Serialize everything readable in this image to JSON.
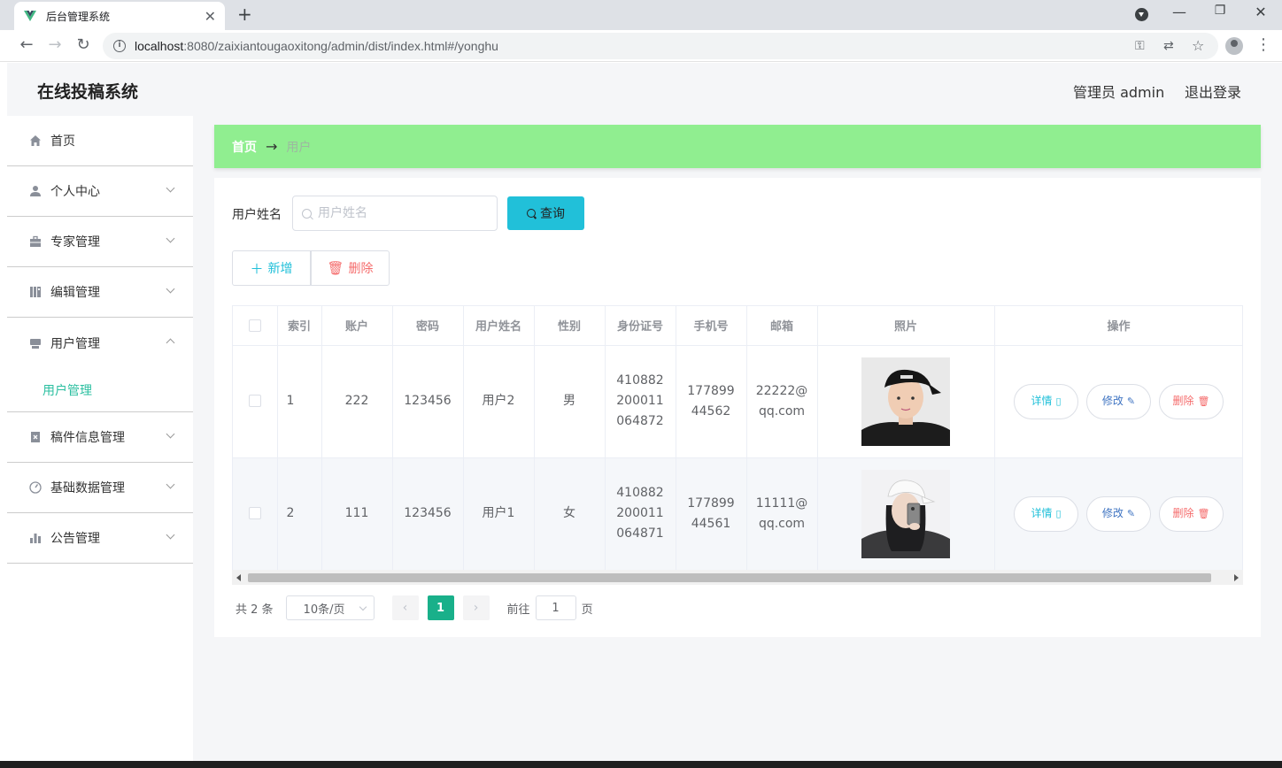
{
  "browser": {
    "tab_title": "后台管理系统",
    "url_host": "localhost",
    "url_path": ":8080/zaixiantougaoxitong/admin/dist/index.html#/yonghu"
  },
  "header": {
    "app_title": "在线投稿系统",
    "admin_label": "管理员 admin",
    "logout_label": "退出登录"
  },
  "sidebar": {
    "items": [
      {
        "label": "首页",
        "icon": "home-icon"
      },
      {
        "label": "个人中心",
        "icon": "user-icon"
      },
      {
        "label": "专家管理",
        "icon": "briefcase-icon"
      },
      {
        "label": "编辑管理",
        "icon": "book-icon"
      },
      {
        "label": "用户管理",
        "icon": "box-icon"
      },
      {
        "label": "稿件信息管理",
        "icon": "document-icon"
      },
      {
        "label": "基础数据管理",
        "icon": "gauge-icon"
      },
      {
        "label": "公告管理",
        "icon": "chart-icon"
      }
    ],
    "submenu_label": "用户管理"
  },
  "breadcrumb": {
    "home": "首页",
    "separator": "→",
    "current": "用户"
  },
  "search": {
    "label": "用户姓名",
    "placeholder": "用户姓名",
    "button_label": "查询"
  },
  "actions": {
    "add_label": "新增",
    "delete_label": "删除"
  },
  "table": {
    "columns": [
      "索引",
      "账户",
      "密码",
      "用户姓名",
      "性别",
      "身份证号",
      "手机号",
      "邮箱",
      "照片",
      "操作"
    ],
    "rows": [
      {
        "index": "1",
        "account": "222",
        "password": "123456",
        "name": "用户2",
        "gender": "男",
        "id_card": "410882200011064872",
        "phone": "17789944562",
        "email": "22222@qq.com",
        "photo": "male-avatar"
      },
      {
        "index": "2",
        "account": "111",
        "password": "123456",
        "name": "用户1",
        "gender": "女",
        "id_card": "410882200011064871",
        "phone": "17789944561",
        "email": "11111@qq.com",
        "photo": "female-avatar"
      }
    ],
    "op_detail": "详情",
    "op_edit": "修改",
    "op_delete": "删除"
  },
  "pagination": {
    "total": "共 2 条",
    "page_size": "10条/页",
    "current_page": "1",
    "goto_prefix": "前往",
    "goto_value": "1",
    "goto_suffix": "页"
  },
  "colors": {
    "accent": "#21c0d9",
    "breadcrumb_bg": "#90ee90",
    "active_page": "#19b08a",
    "danger": "#f56c6c",
    "edit": "#3f74c2"
  }
}
